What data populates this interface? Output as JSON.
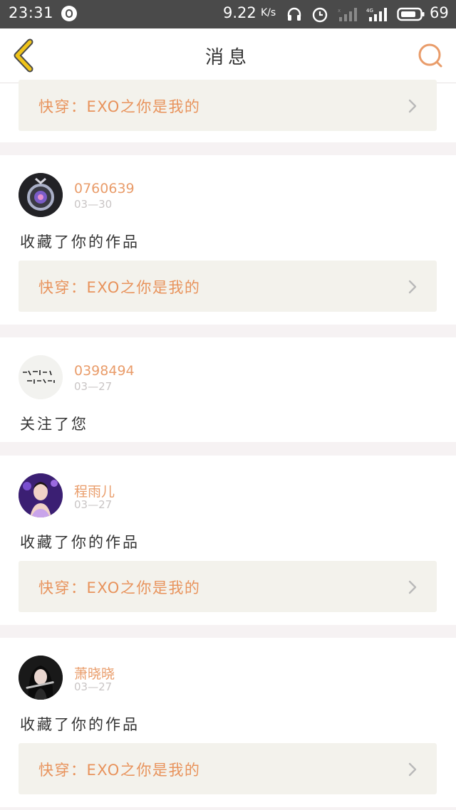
{
  "status_bar": {
    "time": "23:31",
    "net_speed": "9.22",
    "net_speed_unit": "K/s",
    "battery": "69",
    "icons": [
      "app-icon",
      "headphone-icon",
      "alarm-icon",
      "signal-icon",
      "4g-signal-icon",
      "battery-icon"
    ]
  },
  "nav": {
    "title": "消息",
    "back_icon": "chevron-left-icon",
    "search_icon": "search-icon"
  },
  "colors": {
    "accent": "#e99c6a",
    "back_arrow": "#f0c419",
    "work_box_bg": "#f3f2ec",
    "separator_bg": "#f6f2f3"
  },
  "messages": [
    {
      "work_title": "快穿：EXO之你是我的"
    },
    {
      "user": "0760639",
      "date": "03—30",
      "action": "收藏了你的作品",
      "work_title": "快穿：EXO之你是我的"
    },
    {
      "user": "0398494",
      "date": "03—27",
      "action": "关注了您"
    },
    {
      "user": "程雨儿",
      "date": "03—27",
      "action": "收藏了你的作品",
      "work_title": "快穿：EXO之你是我的"
    },
    {
      "user": "萧晓晓",
      "date": "03—27",
      "action": "收藏了你的作品",
      "work_title": "快穿：EXO之你是我的"
    }
  ]
}
